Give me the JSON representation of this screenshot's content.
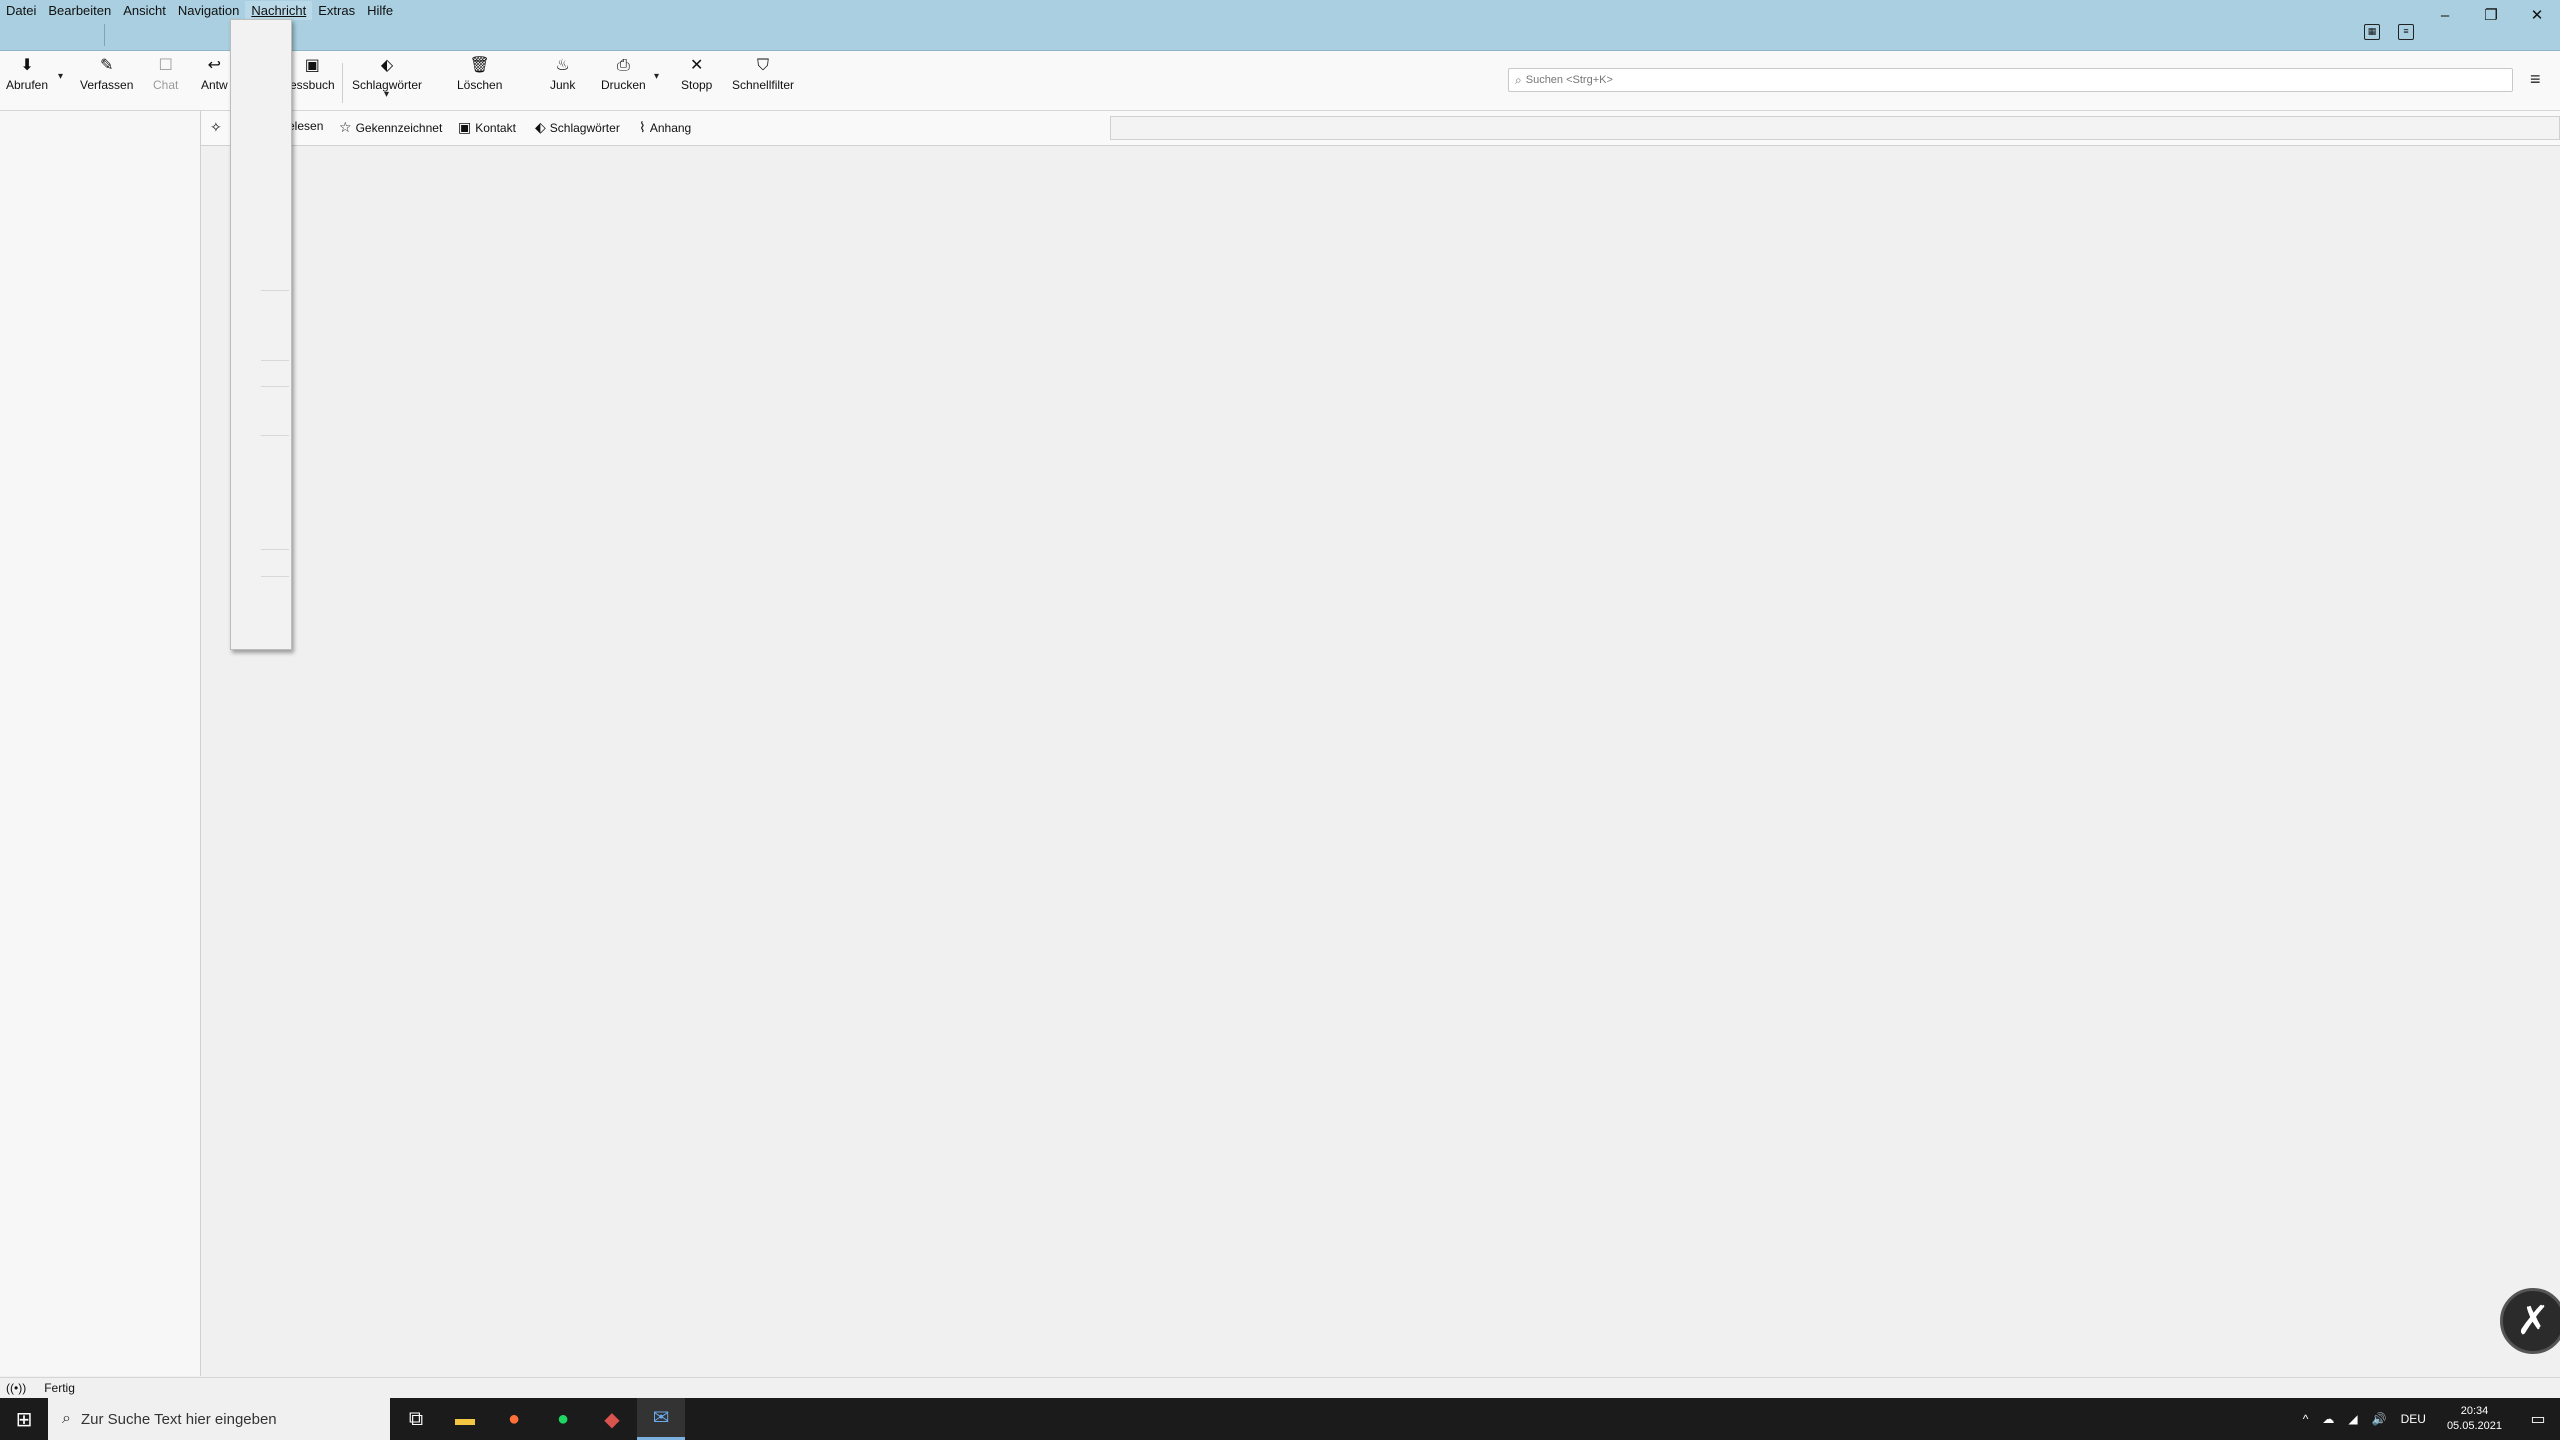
{
  "menubar": {
    "items": [
      "Datei",
      "Bearbeiten",
      "Ansicht",
      "Navigation",
      "Nachricht",
      "Extras",
      "Hilfe"
    ],
    "active": "Nachricht"
  },
  "window_controls": {
    "minimize": "–",
    "restore": "❐",
    "close": "✕"
  },
  "toolbar": {
    "abrufen": "Abrufen",
    "verfassen": "Verfassen",
    "chat": "Chat",
    "antworten": "Antw",
    "adressbuch": "essbuch",
    "schlagwoerter": "Schlagwörter",
    "loeschen": "Löschen",
    "junk": "Junk",
    "drucken": "Drucken",
    "stopp": "Stopp",
    "schnellfilter": "Schnellfilter"
  },
  "search": {
    "placeholder": "Suchen <Strg+K>"
  },
  "filterbar": {
    "ungelesen": "elesen",
    "gekennzeichnet": "Gekennzeichnet",
    "kontakt": "Kontakt",
    "schlagwoerter": "Schlagwörter",
    "anhang": "Anhang"
  },
  "statusbar": {
    "text": "Fertig"
  },
  "taskbar": {
    "search_placeholder": "Zur Suche Text hier eingeben",
    "language": "DEU",
    "time": "20:34",
    "date": "05.05.2021"
  },
  "colors": {
    "titlebar": "#a9cfe0",
    "taskbar": "#1b1b1b",
    "background": "#f0f0f0"
  }
}
